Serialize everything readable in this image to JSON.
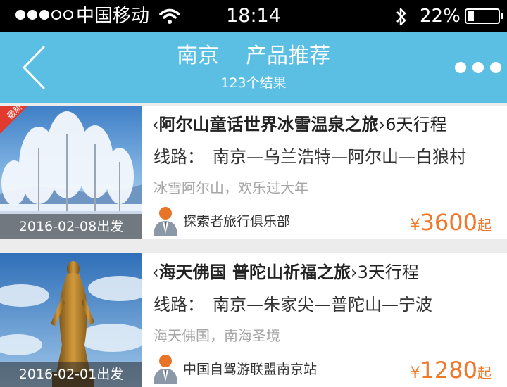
{
  "status_bar": {
    "carrier": "中国移动",
    "time": "18:14",
    "battery": "22%",
    "battery_level": 0.22
  },
  "nav": {
    "city": "南京",
    "title": "产品推荐",
    "subtitle": "123个结果",
    "back_icon": "chevron-left-icon",
    "more_icon": "more-dots-icon"
  },
  "products": [
    {
      "badge": "最新",
      "date": "2016-02-08出发",
      "name": "阿尔山童话世界冰雪温泉之旅",
      "duration": "6天行程",
      "route_label": "线路：",
      "route": "南京—乌兰浩特—阿尔山—白狼村",
      "desc": "冰雪阿尔山，欢乐过大年",
      "agency": "探索者旅行俱乐部",
      "currency": "¥",
      "price": "3600",
      "price_suffix": "起"
    },
    {
      "date": "2016-02-01出发",
      "name": "海天佛国 普陀山祈福之旅",
      "duration": "3天行程",
      "route_label": "线路：",
      "route": "南京—朱家尖—普陀山—宁波",
      "desc": "海天佛国，南海圣境",
      "agency": "中国自驾游联盟南京站",
      "currency": "¥",
      "price": "1280",
      "price_suffix": "起"
    }
  ],
  "colors": {
    "nav_bg": "#5bbfe4",
    "price": "#f0782a",
    "badge": "#e23a2e",
    "avatar_head": "#e8742a"
  }
}
